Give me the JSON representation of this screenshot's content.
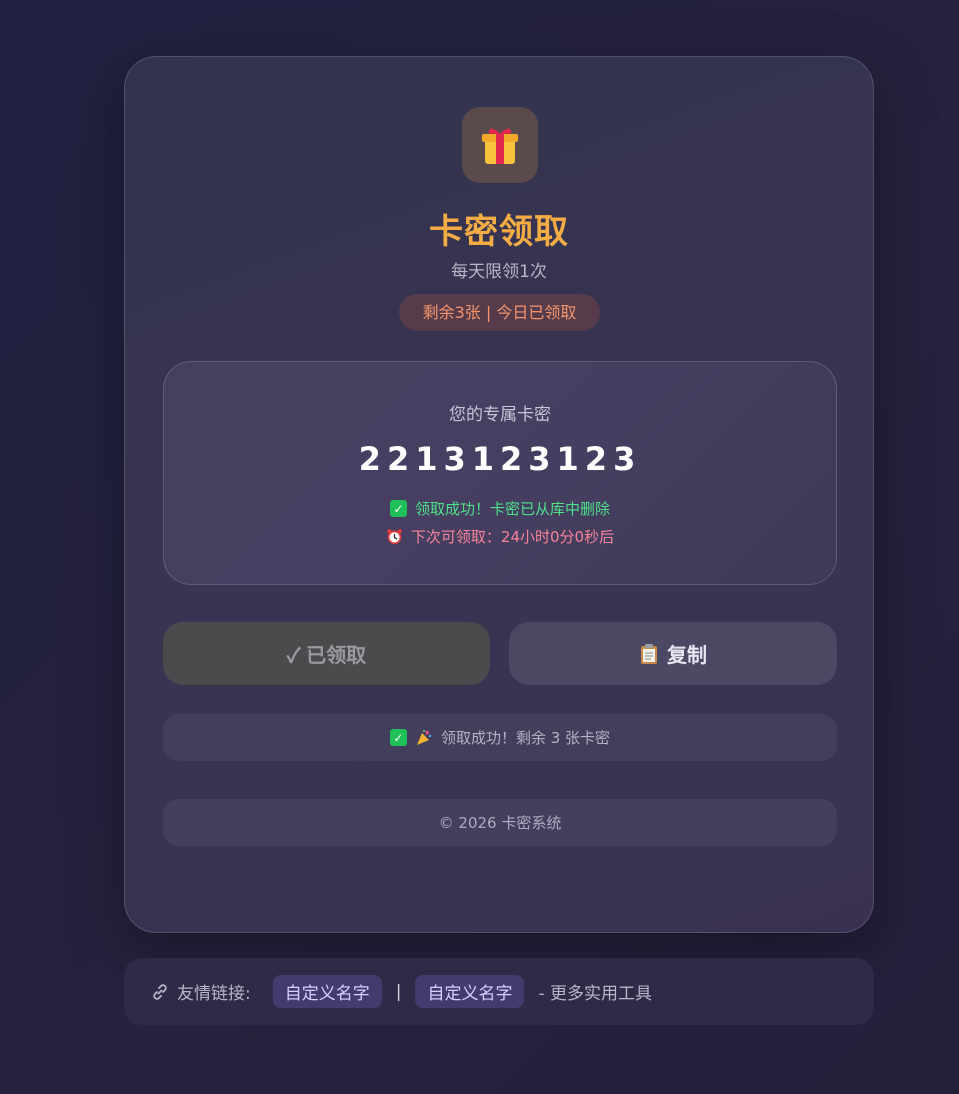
{
  "header": {
    "icon": "gift-icon",
    "title": "卡密领取",
    "subtitle": "每天限领1次",
    "status": "剩余3张 | 今日已领取"
  },
  "code_panel": {
    "label": "您的专属卡密",
    "code": "2213123123",
    "success_icon": "check-icon",
    "success_text": "领取成功！卡密已从库中删除",
    "next_icon": "alarm-clock-icon",
    "next_text": "下次可领取：24小时0分0秒后"
  },
  "buttons": {
    "claimed_label": "✓ 已领取",
    "copy_icon": "clipboard-icon",
    "copy_label": "复制"
  },
  "message": {
    "icons": [
      "check-icon",
      "party-popper-icon"
    ],
    "text": "领取成功！剩余 3 张卡密"
  },
  "footer": {
    "copyright": "© 2026 卡密系统"
  },
  "links": {
    "icon": "link-icon",
    "label": "友情链接:",
    "items": [
      "自定义名字",
      "自定义名字"
    ],
    "separator": "|",
    "more": "- 更多实用工具"
  },
  "colors": {
    "accent_title": "#f4ad45",
    "status_text": "#f6956c",
    "success": "#4ee18a",
    "countdown": "#f7839a"
  }
}
